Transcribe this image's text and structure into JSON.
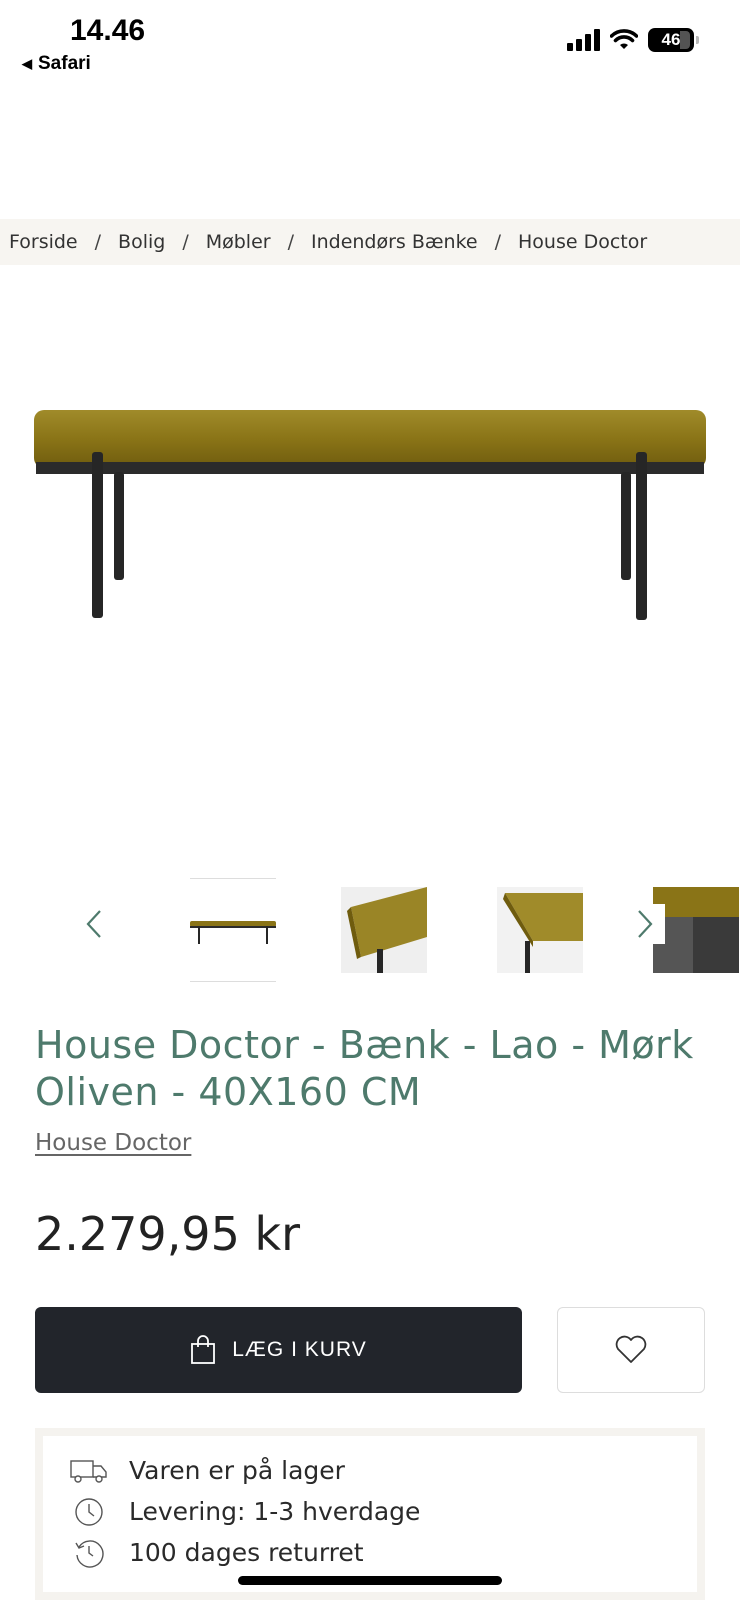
{
  "status_bar": {
    "time": "14.46",
    "back_app": "Safari",
    "battery": "46"
  },
  "breadcrumb": [
    "Forside",
    "Bolig",
    "Møbler",
    "Indendørs Bænke",
    "House Doctor"
  ],
  "breadcrumb_separator": "/",
  "product": {
    "title": "House Doctor - Bænk - Lao - Mørk Oliven - 40X160 CM",
    "brand": "House Doctor",
    "price": "2.279,95 kr",
    "seat_color": "#8e7a1c"
  },
  "gallery": {
    "prev_icon": "chevron-left-icon",
    "next_icon": "chevron-right-icon",
    "thumbnails": [
      "bench-full",
      "bench-corner-closeup",
      "bench-seat-closeup",
      "bench-detail"
    ]
  },
  "actions": {
    "add_to_cart_label": "LÆG I KURV",
    "add_to_cart_icon": "shopping-bag-icon",
    "wishlist_icon": "heart-icon"
  },
  "info": [
    {
      "icon": "truck-icon",
      "text": "Varen er på lager"
    },
    {
      "icon": "clock-icon",
      "text": "Levering: 1-3 hverdage"
    },
    {
      "icon": "return-clock-icon",
      "text": "100 dages returret"
    }
  ],
  "colors": {
    "accent": "#4e7a6c",
    "button_dark": "#22252b",
    "breadcrumb_bg": "#f7f5f1"
  }
}
